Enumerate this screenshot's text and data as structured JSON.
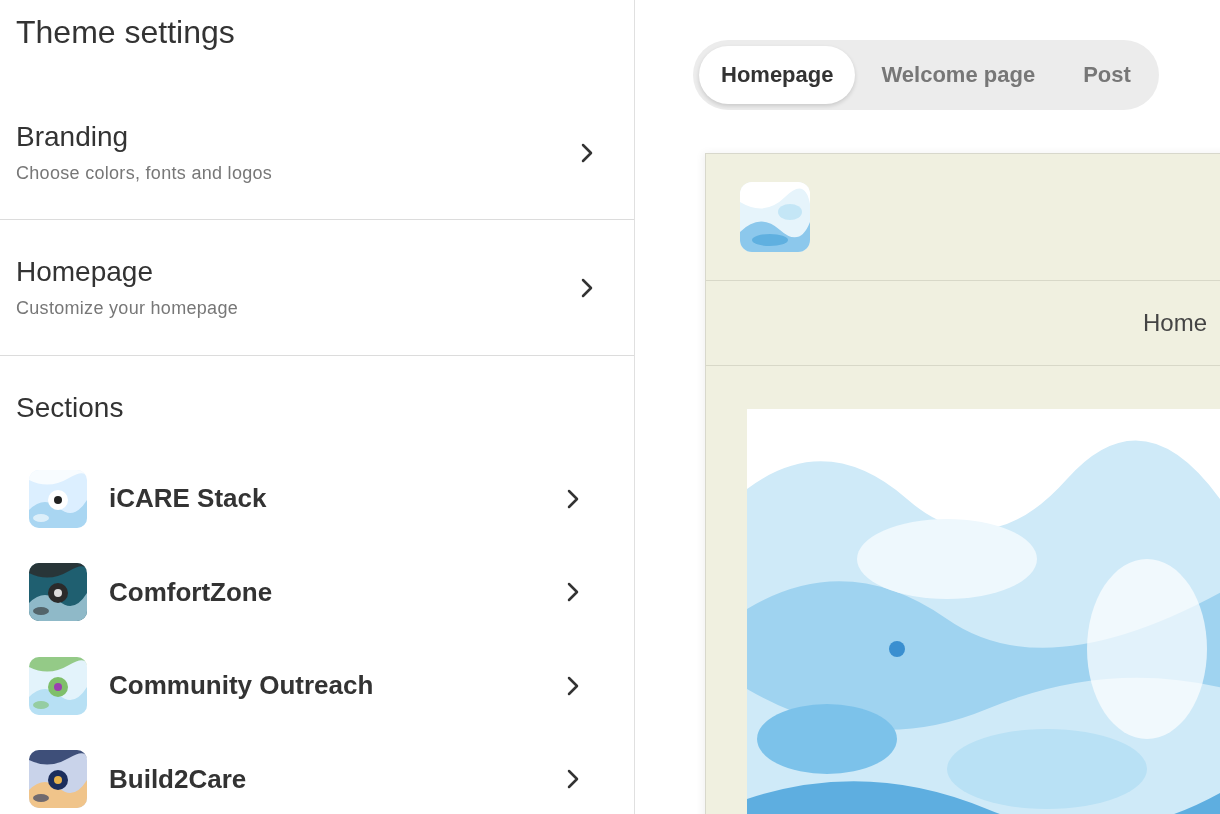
{
  "panel": {
    "title": "Theme settings"
  },
  "menu": [
    {
      "title": "Branding",
      "subtitle": "Choose colors, fonts and logos"
    },
    {
      "title": "Homepage",
      "subtitle": "Customize your homepage"
    }
  ],
  "sections": {
    "heading": "Sections",
    "items": [
      {
        "name": "iCARE Stack"
      },
      {
        "name": "ComfortZone"
      },
      {
        "name": "Community Outreach"
      },
      {
        "name": "Build2Care"
      }
    ]
  },
  "tabs": [
    {
      "label": "Homepage",
      "selected": true
    },
    {
      "label": "Welcome page",
      "selected": false
    },
    {
      "label": "Post",
      "selected": false
    }
  ],
  "preview": {
    "nav": [
      "Home"
    ]
  }
}
